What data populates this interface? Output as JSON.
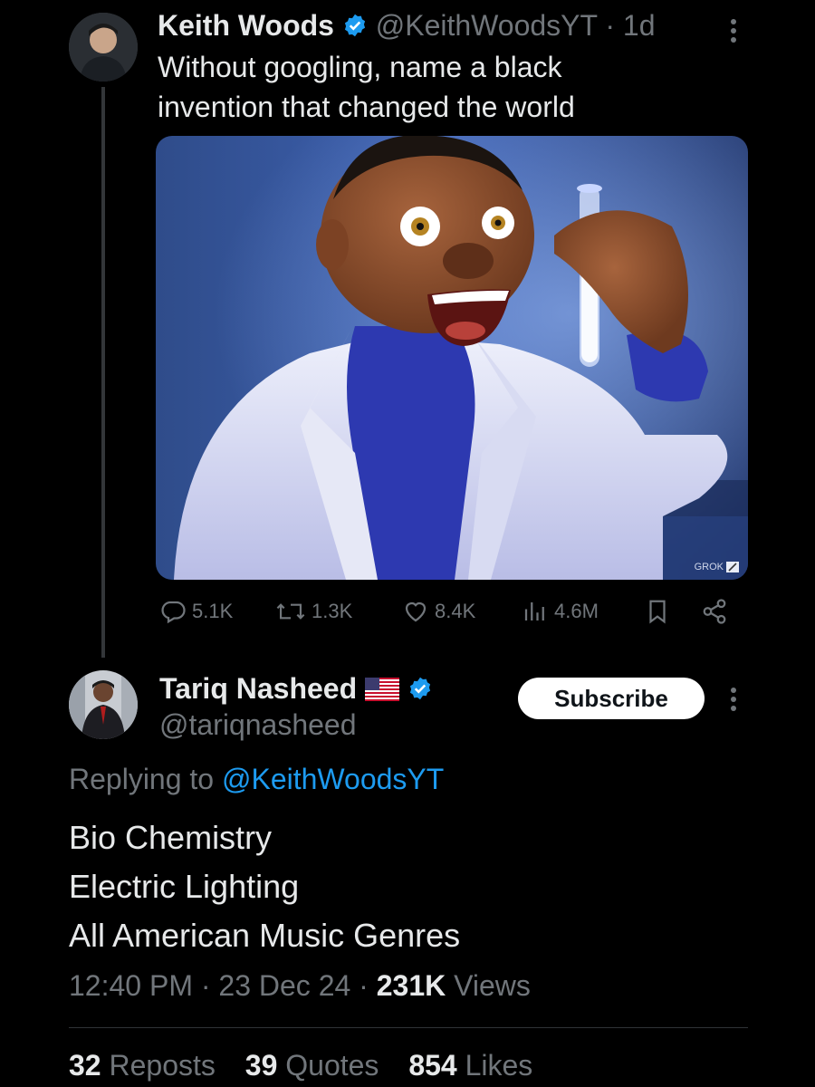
{
  "quoted_tweet": {
    "author_name": "Keith Woods",
    "handle": "@KeithWoodsYT",
    "separator": "·",
    "time": "1d",
    "text_line1": "Without googling, name a black",
    "text_line2": "invention that changed the world",
    "image_badge": "GROK",
    "replies": "5.1K",
    "reposts": "1.3K",
    "likes": "8.4K",
    "views": "4.6M"
  },
  "reply": {
    "author_name": "Tariq Nasheed",
    "handle": "@tariqnasheed",
    "subscribe_label": "Subscribe",
    "replying_prefix": "Replying to",
    "replying_handle": "@KeithWoodsYT",
    "lines": [
      "Bio Chemistry",
      "Electric Lighting",
      "All American Music Genres"
    ],
    "time": "12:40 PM",
    "date": "23 Dec 24",
    "views_count": "231K",
    "views_label": "Views",
    "reposts_count": "32",
    "reposts_label": "Reposts",
    "quotes_count": "39",
    "quotes_label": "Quotes",
    "likes_count": "854",
    "likes_label": "Likes"
  },
  "colors": {
    "background": "#000000",
    "text": "#e7e9ea",
    "muted": "#71767b",
    "accent": "#1d9bf0",
    "verified": "#1d9bf0"
  },
  "icons": [
    "verified-badge-icon",
    "more-icon",
    "reply-icon",
    "repost-icon",
    "like-icon",
    "views-icon",
    "bookmark-icon",
    "share-icon",
    "us-flag-icon"
  ]
}
